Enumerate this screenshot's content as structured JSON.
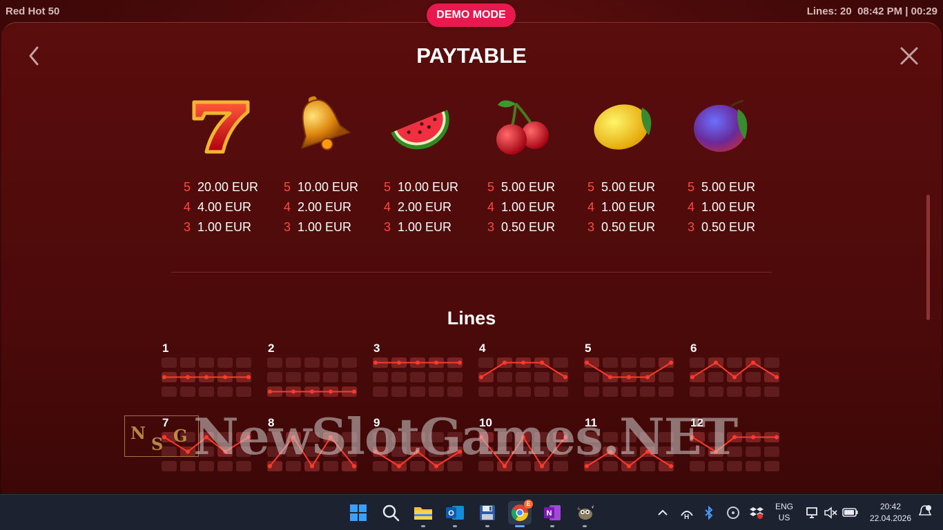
{
  "topbar": {
    "game_title": "Red Hot 50",
    "status": "Lines: 20  08:42 PM | 00:29",
    "demo_badge": "DEMO MODE"
  },
  "paytable": {
    "title": "PAYTABLE",
    "symbols": [
      {
        "icon": "seven-icon",
        "payouts": [
          {
            "count": "5",
            "amount": "20.00 EUR"
          },
          {
            "count": "4",
            "amount": "4.00 EUR"
          },
          {
            "count": "3",
            "amount": "1.00 EUR"
          }
        ]
      },
      {
        "icon": "bell-icon",
        "payouts": [
          {
            "count": "5",
            "amount": "10.00 EUR"
          },
          {
            "count": "4",
            "amount": "2.00 EUR"
          },
          {
            "count": "3",
            "amount": "1.00 EUR"
          }
        ]
      },
      {
        "icon": "watermelon-icon",
        "payouts": [
          {
            "count": "5",
            "amount": "10.00 EUR"
          },
          {
            "count": "4",
            "amount": "2.00 EUR"
          },
          {
            "count": "3",
            "amount": "1.00 EUR"
          }
        ]
      },
      {
        "icon": "cherry-icon",
        "payouts": [
          {
            "count": "5",
            "amount": "5.00 EUR"
          },
          {
            "count": "4",
            "amount": "1.00 EUR"
          },
          {
            "count": "3",
            "amount": "0.50 EUR"
          }
        ]
      },
      {
        "icon": "lemon-icon",
        "payouts": [
          {
            "count": "5",
            "amount": "5.00 EUR"
          },
          {
            "count": "4",
            "amount": "1.00 EUR"
          },
          {
            "count": "3",
            "amount": "0.50 EUR"
          }
        ]
      },
      {
        "icon": "plum-icon",
        "payouts": [
          {
            "count": "5",
            "amount": "5.00 EUR"
          },
          {
            "count": "4",
            "amount": "1.00 EUR"
          },
          {
            "count": "3",
            "amount": "0.50 EUR"
          }
        ]
      }
    ]
  },
  "lines": {
    "title": "Lines",
    "items": [
      {
        "label": "1",
        "rows": [
          1,
          1,
          1,
          1,
          1
        ]
      },
      {
        "label": "2",
        "rows": [
          2,
          2,
          2,
          2,
          2
        ]
      },
      {
        "label": "3",
        "rows": [
          0,
          0,
          0,
          0,
          0
        ]
      },
      {
        "label": "4",
        "rows": [
          1,
          0,
          0,
          0,
          1
        ]
      },
      {
        "label": "5",
        "rows": [
          0,
          1,
          1,
          1,
          0
        ]
      },
      {
        "label": "6",
        "rows": [
          1,
          0,
          1,
          0,
          1
        ]
      },
      {
        "label": "7",
        "rows": [
          0,
          1,
          0,
          1,
          0
        ]
      },
      {
        "label": "8",
        "rows": [
          2,
          0,
          2,
          0,
          2
        ]
      },
      {
        "label": "9",
        "rows": [
          1,
          2,
          1,
          2,
          1
        ]
      },
      {
        "label": "10",
        "rows": [
          0,
          2,
          0,
          2,
          0
        ]
      },
      {
        "label": "11",
        "rows": [
          2,
          1,
          2,
          1,
          2
        ]
      },
      {
        "label": "12",
        "rows": [
          0,
          1,
          0,
          0,
          0
        ]
      }
    ]
  },
  "watermark": {
    "logo_letters": [
      "N",
      "S",
      "G"
    ],
    "text": "NewSlotGames.NET"
  },
  "colors": {
    "accent": "#e8194f",
    "line_color": "#ff3a2a",
    "payout_count": "#ff4a3a"
  },
  "taskbar": {
    "apps": [
      {
        "icon": "windows-start-icon"
      },
      {
        "icon": "search-icon"
      },
      {
        "icon": "file-explorer-icon"
      },
      {
        "icon": "outlook-icon"
      },
      {
        "icon": "save-disk-icon"
      },
      {
        "icon": "chrome-icon",
        "badge": "E"
      },
      {
        "icon": "onenote-icon"
      },
      {
        "icon": "gimp-icon"
      }
    ],
    "tray": {
      "language": "ENG",
      "region": "US",
      "time": "20:42",
      "date": "22.04.2026"
    }
  }
}
